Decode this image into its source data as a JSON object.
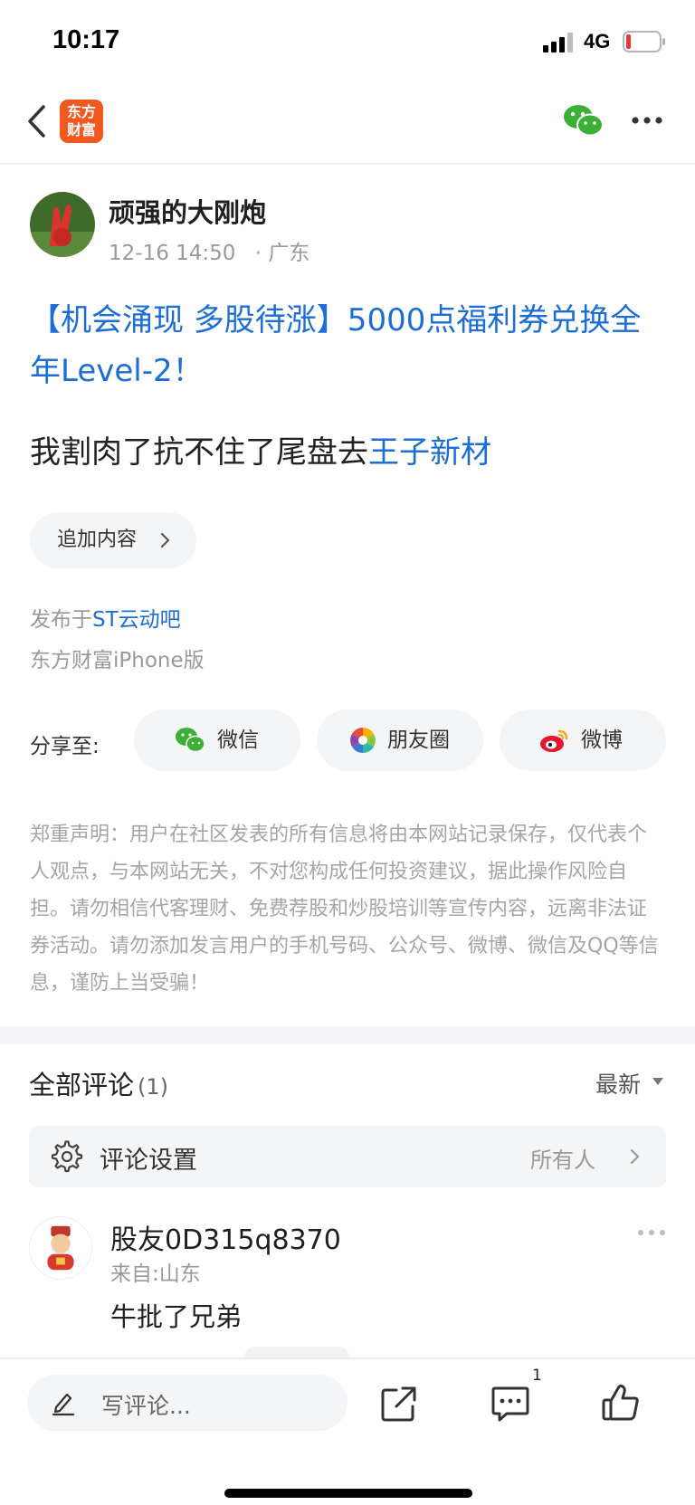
{
  "status_bar": {
    "time": "10:17",
    "network": "4G"
  },
  "nav": {
    "logo_line1": "东方",
    "logo_line2": "财富"
  },
  "post": {
    "author": "顽强的大刚炮",
    "date": "12-16 14:50",
    "location": "· 广东",
    "title": "【机会涌现 多股待涨】5000点福利券兑换全年Level-2！",
    "body_text": "我割肉了抗不住了尾盘去",
    "body_link": "王子新材",
    "append_label": "追加内容",
    "published_prefix": "发布于",
    "published_board": "ST云动吧",
    "client": "东方财富iPhone版"
  },
  "share": {
    "label": "分享至:",
    "targets": [
      {
        "label": "微信",
        "icon": "wechat-icon"
      },
      {
        "label": "朋友圈",
        "icon": "moments-icon"
      },
      {
        "label": "微博",
        "icon": "weibo-icon"
      }
    ]
  },
  "disclaimer": "郑重声明：用户在社区发表的所有信息将由本网站记录保存，仅代表个人观点，与本网站无关，不对您构成任何投资建议，据此操作风险自担。请勿相信代客理财、免费荐股和炒股培训等宣传内容，远离非法证券活动。请勿添加发言用户的手机号码、公众号、微博、微信及QQ等信息，谨防上当受骗！",
  "comments": {
    "header": "全部评论",
    "count": "(1)",
    "sort": "最新",
    "settings_label": "评论设置",
    "settings_value": "所有人",
    "items": [
      {
        "user": "股友0D315q8370",
        "from": "来自:山东",
        "text": "牛批了兄弟"
      }
    ]
  },
  "bottom_bar": {
    "placeholder": "写评论...",
    "comment_count": "1"
  },
  "colors": {
    "link": "#1c6ed6",
    "brand": "#f1591f",
    "wechat": "#3cb034",
    "weibo": "#e6162d"
  }
}
